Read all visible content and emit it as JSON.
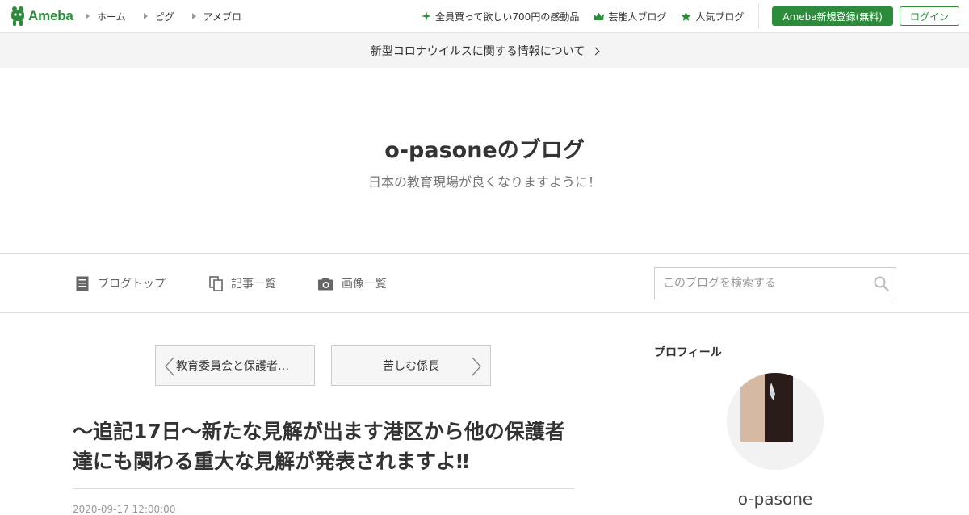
{
  "global_header": {
    "logo_text": "Ameba",
    "nav_links": [
      "ホーム",
      "ピグ",
      "アメブロ"
    ],
    "promo_links": [
      {
        "label": "全員買って欲しい700円の感動品",
        "icon": "sparkle-icon"
      },
      {
        "label": "芸能人ブログ",
        "icon": "crown-icon"
      },
      {
        "label": "人気ブログ",
        "icon": "star-icon"
      }
    ],
    "register_label": "Ameba新規登録(無料)",
    "login_label": "ログイン",
    "accent_color": "#2d8c3c"
  },
  "notice": {
    "text": "新型コロナウイルスに関する情報について"
  },
  "blog": {
    "title": "o-pasoneのブログ",
    "description": "日本の教育現場が良くなりますように！"
  },
  "blog_nav": {
    "items": [
      {
        "label": "ブログトップ",
        "icon": "document-icon"
      },
      {
        "label": "記事一覧",
        "icon": "copy-icon"
      },
      {
        "label": "画像一覧",
        "icon": "camera-icon"
      }
    ],
    "search_placeholder": "このブログを検索する"
  },
  "pager": {
    "prev_label": "教育委員会と保護者…",
    "next_label": "苦しむ係長"
  },
  "article": {
    "title": "〜追記17日〜新たな見解が出ます港区から他の保護者達にも関わる重大な見解が発表されますよ‼︎",
    "date": "2020-09-17 12:00:00"
  },
  "sidebar": {
    "profile_heading": "プロフィール",
    "profile_name": "o-pasone"
  }
}
